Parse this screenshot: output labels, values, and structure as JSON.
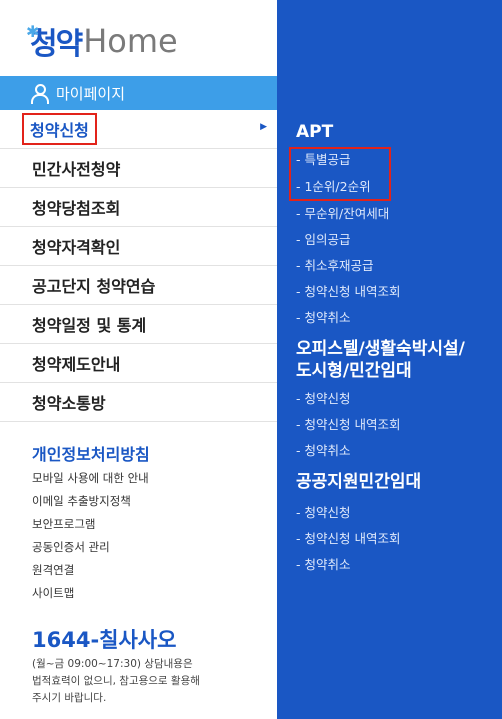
{
  "logo": {
    "prefix": "청약",
    "suffix": "Home"
  },
  "mypage": {
    "label": "마이페이지"
  },
  "menu": [
    {
      "label": "청약신청"
    },
    {
      "label": "민간사전청약"
    },
    {
      "label": "청약당첨조회"
    },
    {
      "label": "청약자격확인"
    },
    {
      "label": "공고단지 청약연습"
    },
    {
      "label": "청약일정 및 통계"
    },
    {
      "label": "청약제도안내"
    },
    {
      "label": "청약소통방"
    }
  ],
  "privacy": {
    "title": "개인정보처리방침"
  },
  "links": [
    "모바일 사용에 대한 안내",
    "이메일 추출방지정책",
    "보안프로그램",
    "공동인증서 관리",
    "원격연결",
    "사이트맵"
  ],
  "contact": {
    "phone": "1644-칠사사오",
    "note_lines": [
      "(월~금 09:00~17:30) 상담내용은",
      "법적효력이 없으니, 참고용으로 활용해",
      "주시기 바랍니다."
    ]
  },
  "submenu": {
    "apt": {
      "title": "APT",
      "items": [
        "- 특별공급",
        "- 1순위/2순위",
        "- 무순위/잔여세대",
        "- 임의공급",
        "- 취소후재공급",
        "- 청약신청 내역조회",
        "- 청약취소"
      ]
    },
    "officetel": {
      "title_line1": "오피스텔/생활숙박시설/",
      "title_line2": "도시형/민간임대",
      "items": [
        "- 청약신청",
        "- 청약신청 내역조회",
        "- 청약취소"
      ]
    },
    "public_rental": {
      "title": "공공지원민간임대",
      "items": [
        "- 청약신청",
        "- 청약신청 내역조회",
        "- 청약취소"
      ]
    }
  },
  "colors": {
    "brand_blue": "#1a57c4",
    "mypage_blue": "#3d9ee8",
    "highlight_red": "#e2231a"
  }
}
